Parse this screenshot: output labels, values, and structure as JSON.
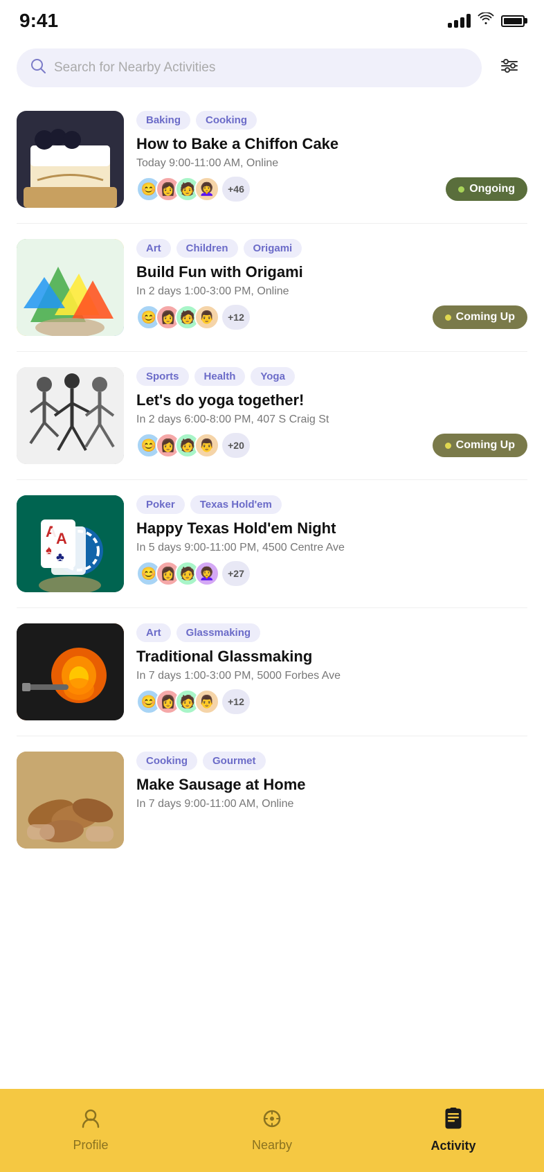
{
  "status": {
    "time": "9:41"
  },
  "search": {
    "placeholder": "Search for Nearby Activities",
    "filter_label": "filter"
  },
  "activities": [
    {
      "id": 1,
      "tags": [
        "Baking",
        "Cooking"
      ],
      "title": "How to Bake a Chiffon Cake",
      "time": "Today 9:00-11:00 AM, Online",
      "participant_count": "+46",
      "status": "Ongoing",
      "status_type": "ongoing",
      "image_class": "img-cake"
    },
    {
      "id": 2,
      "tags": [
        "Art",
        "Children",
        "Origami"
      ],
      "title": "Build Fun with Origami",
      "time": "In 2 days 1:00-3:00 PM, Online",
      "participant_count": "+12",
      "status": "Coming Up",
      "status_type": "coming-up",
      "image_class": "img-origami"
    },
    {
      "id": 3,
      "tags": [
        "Sports",
        "Health",
        "Yoga"
      ],
      "title": "Let's do yoga together!",
      "time": "In 2 days 6:00-8:00 PM, 407 S Craig St",
      "participant_count": "+20",
      "status": "Coming Up",
      "status_type": "coming-up",
      "image_class": "img-yoga"
    },
    {
      "id": 4,
      "tags": [
        "Poker",
        "Texas Hold'em"
      ],
      "title": "Happy Texas Hold'em Night",
      "time": "In 5 days 9:00-11:00 PM, 4500 Centre Ave",
      "participant_count": "+27",
      "status": null,
      "status_type": null,
      "image_class": "img-poker"
    },
    {
      "id": 5,
      "tags": [
        "Art",
        "Glassmaking"
      ],
      "title": "Traditional Glassmaking",
      "time": "In 7 days 1:00-3:00 PM, 5000 Forbes Ave",
      "participant_count": "+12",
      "status": null,
      "status_type": null,
      "image_class": "img-glass"
    },
    {
      "id": 6,
      "tags": [
        "Cooking",
        "Gourmet"
      ],
      "title": "Make Sausage at Home",
      "time": "In 7 days 9:00-11:00 AM, Online",
      "participant_count": null,
      "status": null,
      "status_type": null,
      "image_class": "img-sausage"
    }
  ],
  "nav": {
    "items": [
      {
        "id": "profile",
        "label": "Profile",
        "icon": "person",
        "active": false
      },
      {
        "id": "nearby",
        "label": "Nearby",
        "icon": "nearby",
        "active": false
      },
      {
        "id": "activity",
        "label": "Activity",
        "icon": "bookmark",
        "active": true
      }
    ]
  }
}
